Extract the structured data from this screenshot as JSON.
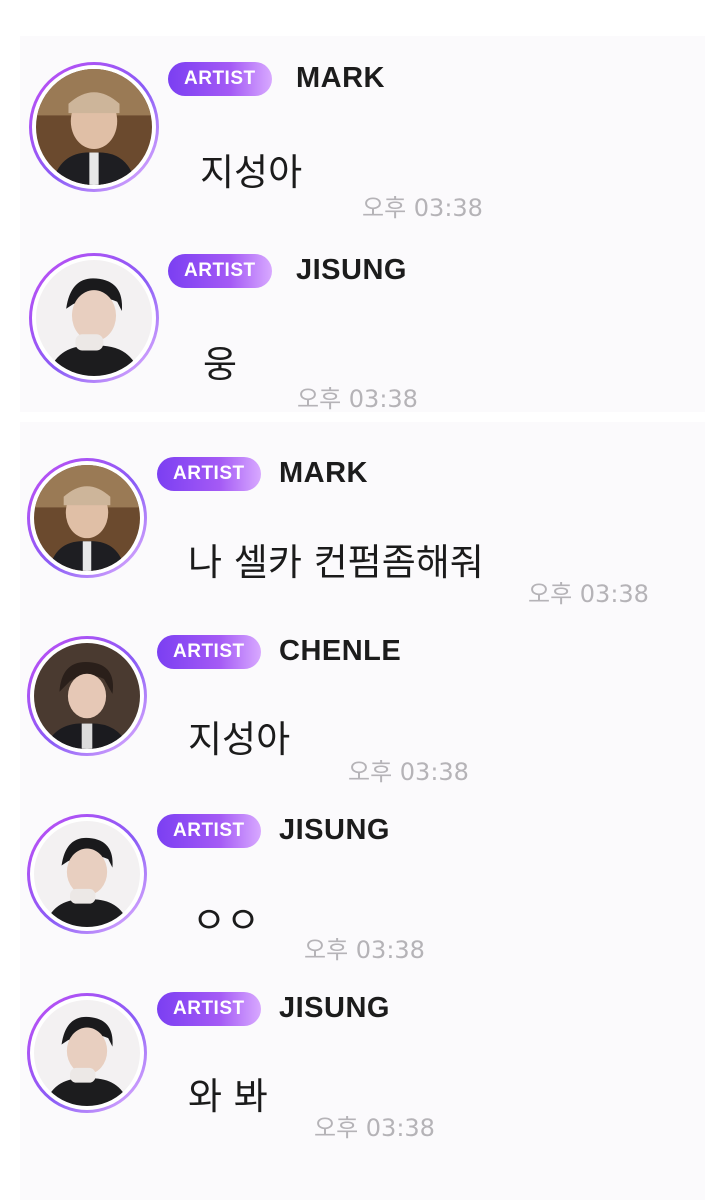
{
  "badge_label": "ARTIST",
  "colors": {
    "badge_start": "#7b3ff2",
    "badge_end": "#d8a9ff",
    "avatar_ring": "#b04cf4",
    "timestamp": "#b5b3b7"
  },
  "messages": [
    {
      "sender": "MARK",
      "text": "지성아",
      "time": "오후 03:38"
    },
    {
      "sender": "JISUNG",
      "text": "웅",
      "time": "오후 03:38"
    },
    {
      "sender": "MARK",
      "text": "나 셀카 컨펌좀해줘",
      "time": "오후 03:38"
    },
    {
      "sender": "CHENLE",
      "text": "지성아",
      "time": "오후 03:38"
    },
    {
      "sender": "JISUNG",
      "text": "ㅇㅇ",
      "time": "오후 03:38"
    },
    {
      "sender": "JISUNG",
      "text": "와 봐",
      "time": "오후 03:38"
    }
  ]
}
